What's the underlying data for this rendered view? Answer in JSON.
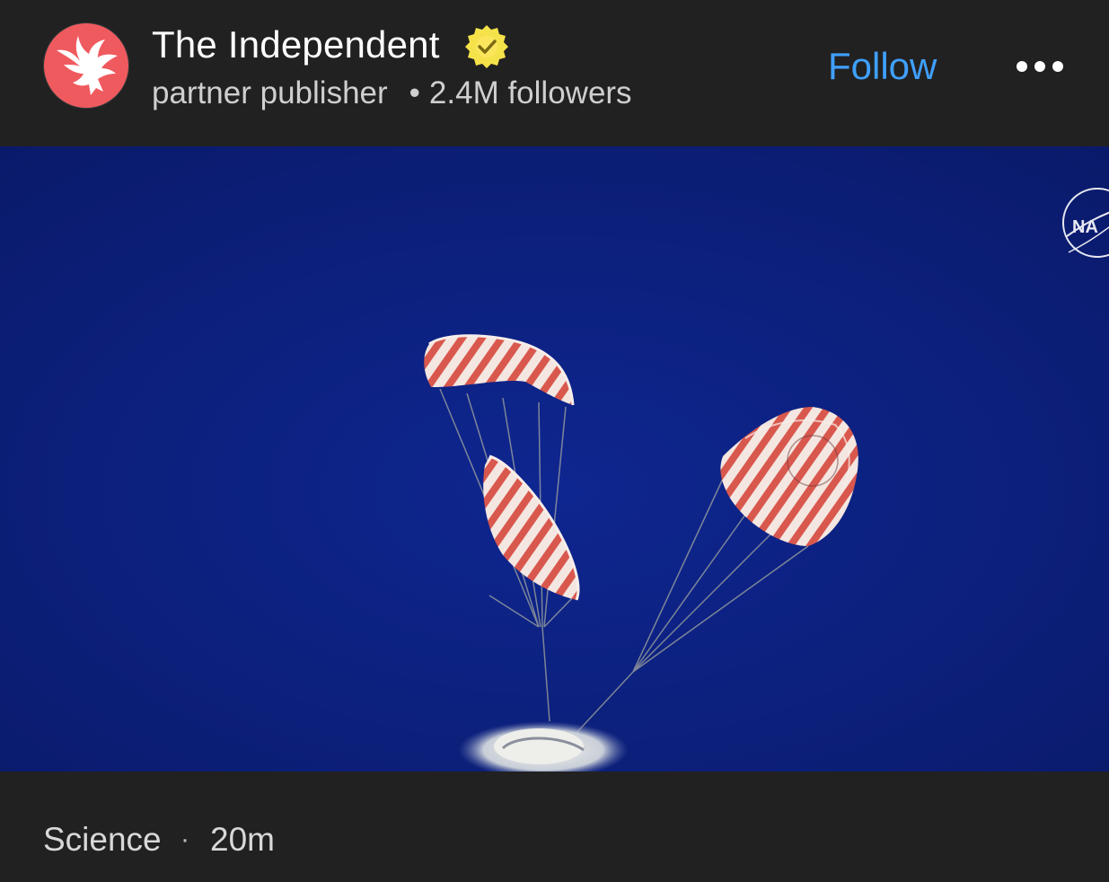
{
  "post": {
    "publisher_name": "The Independent",
    "publisher_type": "partner publisher",
    "separator": "•",
    "followers": "2.4M followers",
    "follow_label": "Follow",
    "verified_icon": "verified-badge-icon",
    "avatar_icon": "eagle-logo-icon",
    "more_icon": "more-options-icon"
  },
  "media": {
    "watermark_text": "NA"
  },
  "footer": {
    "category": "Science",
    "separator": "·",
    "time": "20m"
  },
  "colors": {
    "background": "#212121",
    "avatar": "#ef5a5f",
    "verified_badge": "#f5e24a",
    "follow": "#3fa0ff",
    "sky": "#0c1e78"
  }
}
